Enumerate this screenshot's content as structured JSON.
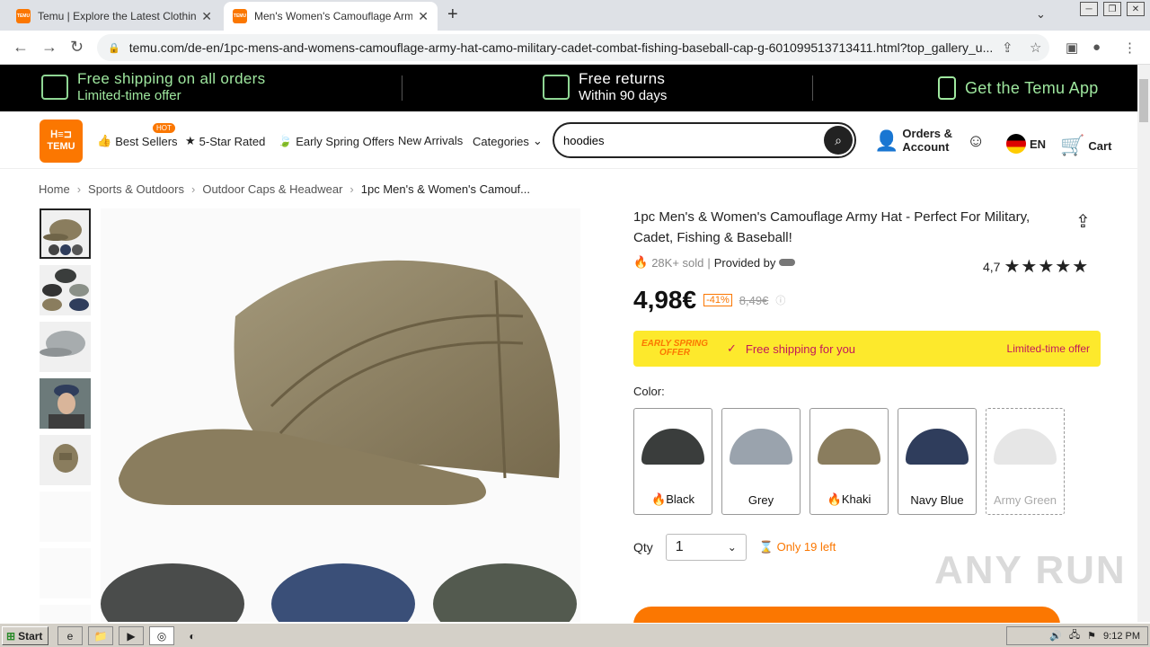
{
  "browser": {
    "tabs": [
      {
        "title": "Temu | Explore the Latest Clothing, B",
        "active": false
      },
      {
        "title": "Men's Women's Camouflage Army Ha",
        "active": true
      }
    ],
    "url": "temu.com/de-en/1pc-mens-and-womens-camouflage-army-hat-camo-military-cadet-combat-fishing-baseball-cap-g-601099513713411.html?top_gallery_u..."
  },
  "promo": {
    "shipping_title": "Free shipping on all orders",
    "shipping_sub": "Limited-time offer",
    "returns_title": "Free returns",
    "returns_sub": "Within 90 days",
    "app": "Get the Temu App"
  },
  "header": {
    "logo_line1": "ᕼ≡⊐",
    "logo_line2": "TEMU",
    "nav": {
      "best_sellers": "Best Sellers",
      "hot_badge": "HOT",
      "five_star": "5-Star Rated",
      "spring": "Early Spring Offers",
      "new_arrivals": "New Arrivals",
      "categories": "Categories"
    },
    "search_value": "hoodies",
    "orders": "Orders &",
    "account": "Account",
    "lang": "EN",
    "cart": "Cart"
  },
  "breadcrumb": [
    "Home",
    "Sports & Outdoors",
    "Outdoor Caps & Headwear",
    "1pc Men's & Women's Camouf..."
  ],
  "product": {
    "title": "1pc Men's & Women's Camouflage Army Hat - Perfect For Military, Cadet, Fishing & Baseball!",
    "sold": "28K+ sold",
    "provided_by": "Provided by",
    "rating": "4,7",
    "rating_value": 4.7,
    "price": "4,98€",
    "discount": "-41%",
    "old_price": "8,49€",
    "shipping_badge": "EARLY SPRING OFFER",
    "shipping_text": "Free shipping for you",
    "limited": "Limited-time offer",
    "color_label": "Color:",
    "colors": [
      {
        "name": "Black",
        "hot": true,
        "hex": "#3a3d3c"
      },
      {
        "name": "Grey",
        "hot": false,
        "hex": "#9aa3ad"
      },
      {
        "name": "Khaki",
        "hot": true,
        "hex": "#8a7d5e"
      },
      {
        "name": "Navy Blue",
        "hot": false,
        "hex": "#2f3d5c"
      },
      {
        "name": "Army Green",
        "hot": false,
        "hex": "#e6e6e6"
      }
    ],
    "qty_label": "Qty",
    "qty_value": "1",
    "stock": "Only 19 left"
  },
  "taskbar": {
    "start": "Start",
    "time": "9:12 PM"
  },
  "watermark": "ANY RUN"
}
